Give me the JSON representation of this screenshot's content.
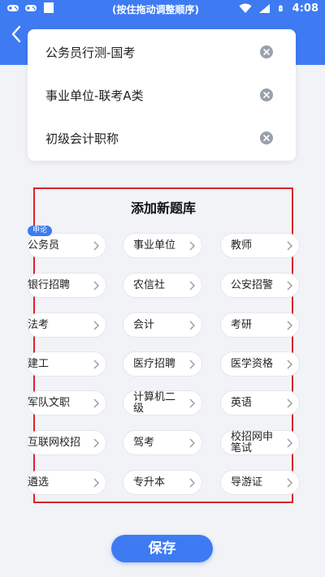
{
  "status_bar": {
    "hint": "(按住拖动调整顺序)",
    "time": "4:08"
  },
  "selected": {
    "items": [
      {
        "label": "公务员行测-国考"
      },
      {
        "label": "事业单位-联考A类"
      },
      {
        "label": "初级会计职称"
      }
    ]
  },
  "add_panel": {
    "title": "添加新题库",
    "badge": "申论",
    "chips": [
      {
        "label": "公务员"
      },
      {
        "label": "事业单位"
      },
      {
        "label": "教师"
      },
      {
        "label": "银行招聘"
      },
      {
        "label": "农信社"
      },
      {
        "label": "公安招警"
      },
      {
        "label": "法考"
      },
      {
        "label": "会计"
      },
      {
        "label": "考研"
      },
      {
        "label": "建工"
      },
      {
        "label": "医疗招聘"
      },
      {
        "label": "医学资格"
      },
      {
        "label": "军队文职"
      },
      {
        "label": "计算机二级"
      },
      {
        "label": "英语"
      },
      {
        "label": "互联网校招"
      },
      {
        "label": "驾考"
      },
      {
        "label": "校招网申笔试"
      },
      {
        "label": "遴选"
      },
      {
        "label": "专升本"
      },
      {
        "label": "导游证"
      }
    ]
  },
  "save_label": "保存",
  "colors": {
    "primary": "#3e7bf3",
    "highlight_border": "#d9232d",
    "background": "#f2f3f7"
  }
}
